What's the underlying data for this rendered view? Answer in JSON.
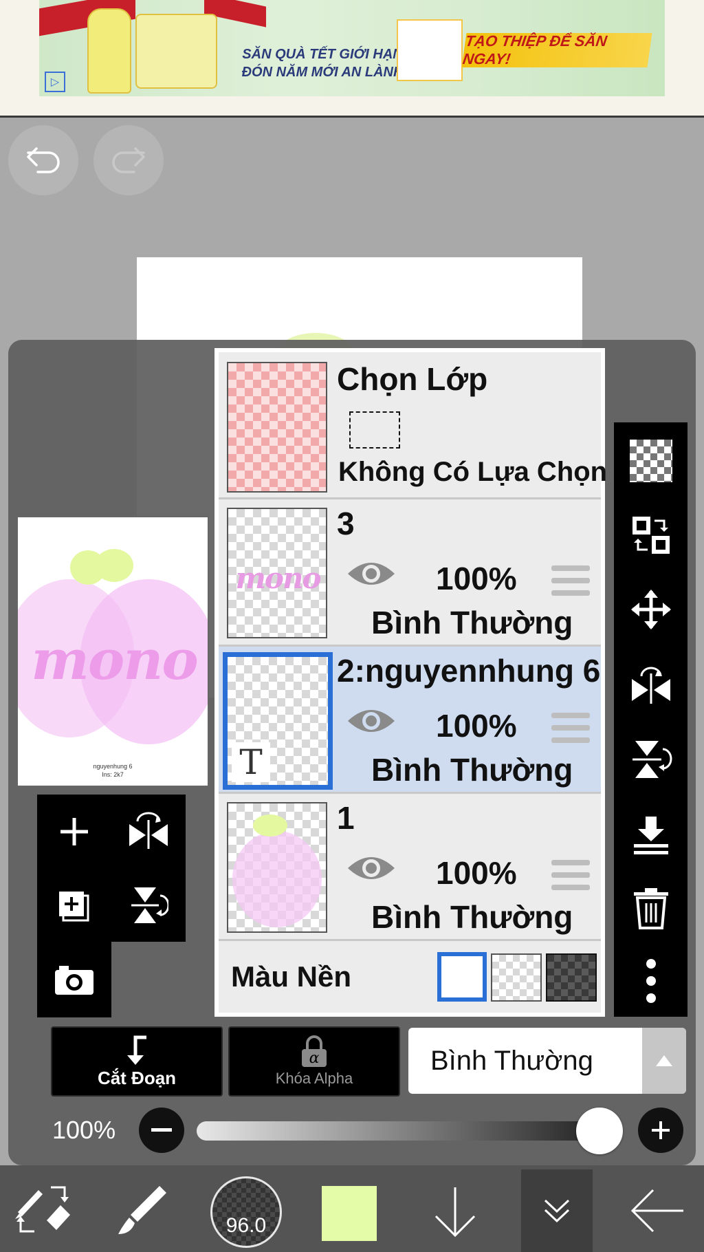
{
  "ad": {
    "headline_line1": "SĂN QUÀ TẾT GIỚI HẠN",
    "headline_line2": "ĐÓN NĂM MỚI AN LÀNH",
    "cta": "TẠO THIỆP ĐỂ SĂN NGAY!",
    "brand_color": "#c8202a"
  },
  "history": {
    "undo_icon": "undo-icon",
    "redo_icon": "redo-icon"
  },
  "canvas_preview": {
    "main_text": "mono",
    "small_text_line1": "nguyenhung 6",
    "small_text_line2": "Ins: 2k7"
  },
  "layers_panel": {
    "selection_layer": {
      "title": "Chọn Lớp",
      "status": "Không Có Lựa Chọn"
    },
    "layers": [
      {
        "name": "3",
        "opacity": "100%",
        "blend": "Bình Thường",
        "thumb_text": "mono",
        "selected": false
      },
      {
        "name": "2:nguyennhung 6",
        "opacity": "100%",
        "blend": "Bình Thường",
        "thumb_text": "T",
        "selected": true
      },
      {
        "name": "1",
        "opacity": "100%",
        "blend": "Bình Thường",
        "thumb_text": "",
        "selected": false
      }
    ],
    "background": {
      "label": "Màu Nền",
      "options": [
        "white",
        "transparent",
        "dark-checker"
      ],
      "selected": "white"
    }
  },
  "layer_actions": {
    "add_layer_icon": "plus-icon",
    "flip_h_icon": "flip-horizontal-icon",
    "copy_layer_icon": "duplicate-layer-icon",
    "flip_v_icon": "flip-vertical-icon",
    "camera_icon": "camera-icon"
  },
  "right_tools": [
    "checker-icon",
    "transform-layer-icon",
    "move-icon",
    "flip-horizontal-icon",
    "flip-vertical-icon",
    "merge-down-icon",
    "trash-icon",
    "more-icon"
  ],
  "controls": {
    "clip_label": "Cắt Đoạn",
    "alpha_lock_label": "Khóa Alpha",
    "blend_mode": "Bình Thường",
    "opacity_label": "100%",
    "opacity_value": 1.0
  },
  "toolbar": {
    "brush_size": "96.0",
    "current_color": "#e4fba8"
  },
  "colors": {
    "selected_highlight": "#cfdcef",
    "selected_border": "#2a6fd6"
  }
}
